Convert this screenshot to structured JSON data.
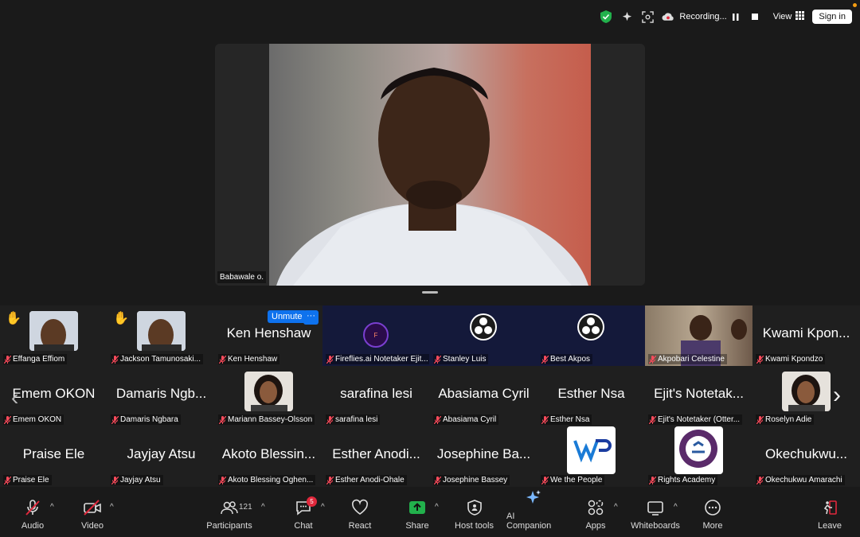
{
  "topbar": {
    "recording_label": "Recording...",
    "view_label": "View",
    "signin_label": "Sign in"
  },
  "speaker": {
    "name": "Babawale o."
  },
  "gallery": {
    "unmute_label": "Unmute",
    "more_label": "···",
    "tiles": [
      {
        "label": "Effanga Effiom"
      },
      {
        "label": "Jackson  Tamunosaki..."
      },
      {
        "big": "Ken Henshaw",
        "label": "Ken Henshaw"
      },
      {
        "label": "Fireflies.ai Notetaker Ejit..."
      },
      {
        "label": "Stanley Luis"
      },
      {
        "label": "Best Akpos"
      },
      {
        "label": "Akpobari Celestine"
      },
      {
        "big": "Kwami Kpon...",
        "label": "Kwami Kpondzo"
      },
      {
        "big": "Emem OKON",
        "label": "Emem OKON"
      },
      {
        "big": "Damaris Ngb...",
        "label": "Damaris Ngbara"
      },
      {
        "label": "Mariann Bassey-Olsson"
      },
      {
        "big": "sarafina lesi",
        "label": "sarafina lesi"
      },
      {
        "big": "Abasiama Cyril",
        "label": "Abasiama Cyril"
      },
      {
        "big": "Esther Nsa",
        "label": "Esther Nsa"
      },
      {
        "big": "Ejit's Notetak...",
        "label": "Ejit's Notetaker (Otter..."
      },
      {
        "label": "Roselyn Adie"
      },
      {
        "big": "Praise Ele",
        "label": "Praise Ele"
      },
      {
        "big": "Jayjay Atsu",
        "label": "Jayjay Atsu"
      },
      {
        "big": "Akoto Blessin...",
        "label": "Akoto Blessing Oghen..."
      },
      {
        "big": "Esther Anodi...",
        "label": "Esther Anodi-Ohale"
      },
      {
        "big": "Josephine Ba...",
        "label": "Josephine Bassey"
      },
      {
        "label": "We the People"
      },
      {
        "label": "Rights Academy"
      },
      {
        "big": "Okechukwu...",
        "label": "Okechukwu Amarachi"
      }
    ]
  },
  "toolbar": {
    "audio": "Audio",
    "video": "Video",
    "participants": "Participants",
    "participants_count": "121",
    "chat": "Chat",
    "chat_badge": "5",
    "react": "React",
    "share": "Share",
    "host_tools": "Host tools",
    "ai_companion": "AI Companion",
    "apps": "Apps",
    "whiteboards": "Whiteboards",
    "more": "More",
    "leave": "Leave"
  },
  "colors": {
    "accent": "#0e72ed",
    "share_green": "#22b14c",
    "danger": "#e0283c"
  }
}
